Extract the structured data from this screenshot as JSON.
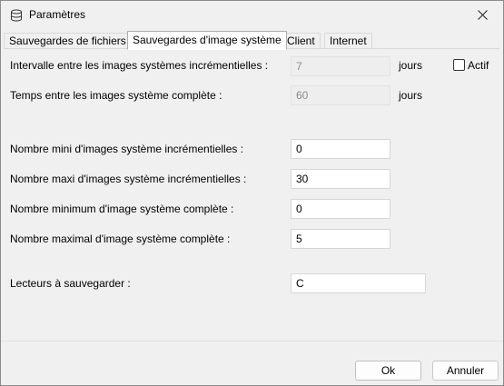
{
  "window": {
    "title": "Paramètres",
    "icon": "database-icon",
    "close_icon": "close-icon"
  },
  "tabs": [
    {
      "label": "Sauvegardes de fichiers",
      "active": false
    },
    {
      "label": "Sauvegardes d'image système",
      "active": true
    },
    {
      "label": "Client",
      "active": false
    },
    {
      "label": "Internet",
      "active": false
    }
  ],
  "form": {
    "incremental_interval": {
      "label": "Intervalle entre les images systèmes incrémentielles :",
      "value": "7",
      "unit": "jours",
      "enabled": false
    },
    "active_checkbox": {
      "label": "Actif",
      "checked": false
    },
    "full_interval": {
      "label": "Temps entre les images système complète :",
      "value": "60",
      "unit": "jours",
      "enabled": false
    },
    "min_incremental": {
      "label": "Nombre mini d'images système incrémentielles :",
      "value": "0"
    },
    "max_incremental": {
      "label": "Nombre maxi d'images système incrémentielles :",
      "value": "30"
    },
    "min_full": {
      "label": "Nombre minimum d'image système complète :",
      "value": "0"
    },
    "max_full": {
      "label": "Nombre maximal d'image système complète :",
      "value": "5"
    },
    "drives": {
      "label": "Lecteurs à sauvegarder :",
      "value": "C"
    }
  },
  "buttons": {
    "ok": "Ok",
    "cancel": "Annuler"
  }
}
